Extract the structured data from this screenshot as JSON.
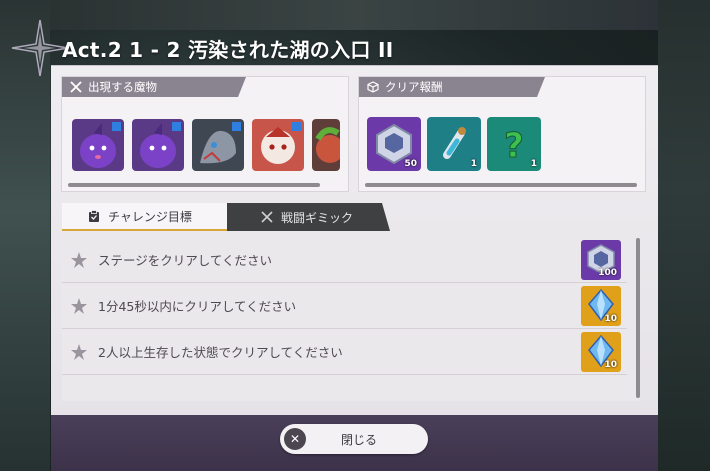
{
  "header": {
    "title": "Act.2 1 - 2 汚染された湖の入口 II"
  },
  "monsters": {
    "label": "出現する魔物",
    "icon": "crossed-swords-icon",
    "items": [
      {
        "name": "purple-slime-1"
      },
      {
        "name": "purple-slime-2"
      },
      {
        "name": "gray-dragon"
      },
      {
        "name": "red-white-creature"
      },
      {
        "name": "green-plant-creature"
      }
    ]
  },
  "rewards": {
    "label": "クリア報酬",
    "icon": "cube-icon",
    "items": [
      {
        "name": "hexagon-emblem",
        "count": "50",
        "color": "#7b3fb3"
      },
      {
        "name": "potion-flask",
        "count": "1",
        "color": "#1f8c8a"
      },
      {
        "name": "question-mark",
        "count": "1",
        "color": "#1d8f7d"
      }
    ]
  },
  "tabs": {
    "challenge": "チャレンジ目標",
    "gimmick": "戦闘ギミック"
  },
  "missions": [
    {
      "text": "ステージをクリアしてください",
      "reward_count": "100",
      "reward_type": "hexagon-emblem"
    },
    {
      "text": "1分45秒以内にクリアしてください",
      "reward_count": "10",
      "reward_type": "blue-crystal"
    },
    {
      "text": "2人以上生存した状態でクリアしてください",
      "reward_count": "10",
      "reward_type": "blue-crystal"
    }
  ],
  "footer": {
    "close_label": "閉じる"
  },
  "colors": {
    "footer_bg": "#3c3249",
    "tab_accent": "#d9a63a",
    "gold_reward": "#e0a019",
    "purple_reward": "#7b3fb3"
  }
}
